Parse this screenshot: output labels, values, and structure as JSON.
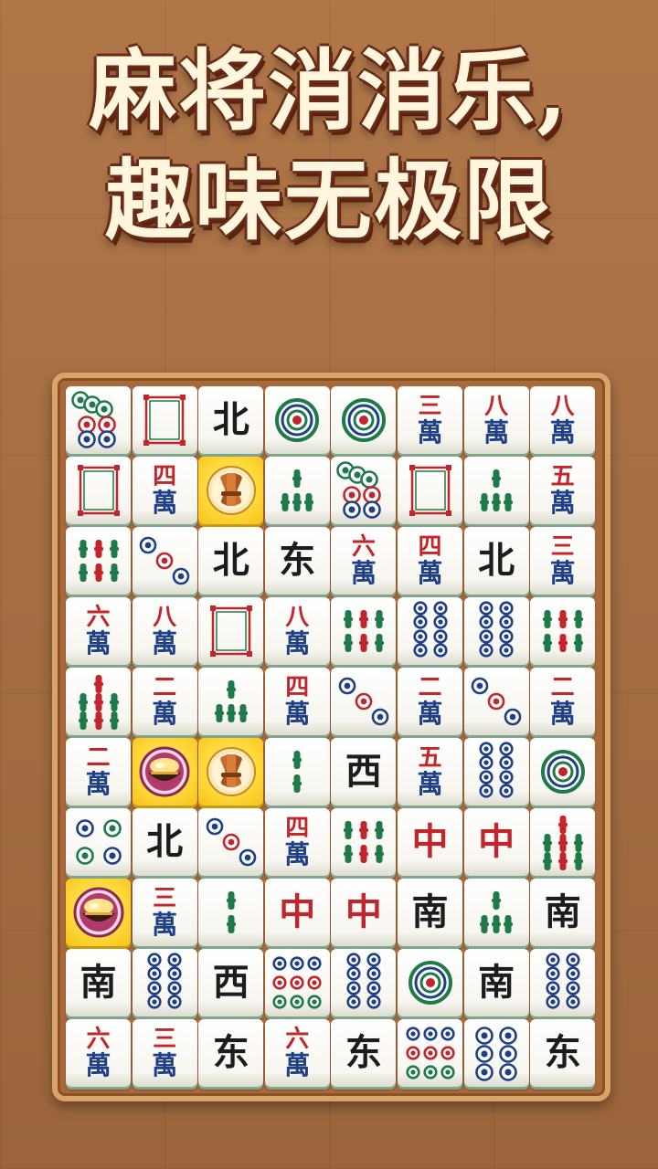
{
  "title": {
    "line1": "麻将消消乐,",
    "line2": "趣味无极限"
  },
  "board": {
    "rows": [
      [
        {
          "k": "dot",
          "n": 7
        },
        {
          "k": "white"
        },
        {
          "k": "char",
          "t": "北"
        },
        {
          "k": "dot",
          "n": 1
        },
        {
          "k": "dot",
          "n": 1
        },
        {
          "k": "wan",
          "n": "三"
        },
        {
          "k": "wan",
          "n": "八"
        },
        {
          "k": "wan",
          "n": "八"
        }
      ],
      [
        {
          "k": "white"
        },
        {
          "k": "wan",
          "n": "四"
        },
        {
          "k": "bamboo-bundle",
          "hl": true
        },
        {
          "k": "bam",
          "n": 5
        },
        {
          "k": "dot",
          "n": 7
        },
        {
          "k": "white"
        },
        {
          "k": "bam",
          "n": 5
        },
        {
          "k": "wan",
          "n": "五"
        }
      ],
      [
        {
          "k": "bam",
          "n": 6
        },
        {
          "k": "dot",
          "n": 3
        },
        {
          "k": "char",
          "t": "北"
        },
        {
          "k": "char",
          "t": "东"
        },
        {
          "k": "wan",
          "n": "六"
        },
        {
          "k": "wan",
          "n": "四"
        },
        {
          "k": "char",
          "t": "北"
        },
        {
          "k": "wan",
          "n": "三"
        }
      ],
      [
        {
          "k": "wan",
          "n": "六"
        },
        {
          "k": "wan",
          "n": "八"
        },
        {
          "k": "white"
        },
        {
          "k": "wan",
          "n": "八"
        },
        {
          "k": "bam",
          "n": 6
        },
        {
          "k": "dot",
          "n": 8
        },
        {
          "k": "dot",
          "n": 8
        },
        {
          "k": "bam",
          "n": 6
        }
      ],
      [
        {
          "k": "bam",
          "n": 9
        },
        {
          "k": "wan",
          "n": "二"
        },
        {
          "k": "bam",
          "n": 5
        },
        {
          "k": "wan",
          "n": "四"
        },
        {
          "k": "dot",
          "n": 3
        },
        {
          "k": "wan",
          "n": "二"
        },
        {
          "k": "dot",
          "n": 3
        },
        {
          "k": "wan",
          "n": "二"
        }
      ],
      [
        {
          "k": "wan",
          "n": "二"
        },
        {
          "k": "gold-pot",
          "hl": true
        },
        {
          "k": "bamboo-bundle",
          "hl": true
        },
        {
          "k": "bam",
          "n": 2
        },
        {
          "k": "char",
          "t": "西"
        },
        {
          "k": "wan",
          "n": "五"
        },
        {
          "k": "dot",
          "n": 8
        },
        {
          "k": "dot",
          "n": 1
        }
      ],
      [
        {
          "k": "dot",
          "n": 4
        },
        {
          "k": "char",
          "t": "北"
        },
        {
          "k": "dot",
          "n": 3
        },
        {
          "k": "wan",
          "n": "四"
        },
        {
          "k": "bam",
          "n": 6
        },
        {
          "k": "char",
          "t": "中"
        },
        {
          "k": "char",
          "t": "中"
        },
        {
          "k": "bam",
          "n": 9
        }
      ],
      [
        {
          "k": "gold-pot",
          "hl": true
        },
        {
          "k": "wan",
          "n": "三"
        },
        {
          "k": "bam",
          "n": 2
        },
        {
          "k": "char",
          "t": "中"
        },
        {
          "k": "char",
          "t": "中"
        },
        {
          "k": "char",
          "t": "南"
        },
        {
          "k": "bam",
          "n": 5
        },
        {
          "k": "char",
          "t": "南"
        }
      ],
      [
        {
          "k": "char",
          "t": "南"
        },
        {
          "k": "dot",
          "n": 8
        },
        {
          "k": "char",
          "t": "西"
        },
        {
          "k": "dot",
          "n": 9
        },
        {
          "k": "dot",
          "n": 8
        },
        {
          "k": "dot",
          "n": 1
        },
        {
          "k": "char",
          "t": "南"
        },
        {
          "k": "dot",
          "n": 8
        }
      ],
      [
        {
          "k": "wan",
          "n": "六"
        },
        {
          "k": "wan",
          "n": "三"
        },
        {
          "k": "char",
          "t": "东"
        },
        {
          "k": "wan",
          "n": "六"
        },
        {
          "k": "char",
          "t": "东"
        },
        {
          "k": "dot",
          "n": 9
        },
        {
          "k": "dot",
          "n": 6
        },
        {
          "k": "char",
          "t": "东"
        }
      ]
    ],
    "wan_glyph": "萬"
  },
  "colors": {
    "red": "#c0262b",
    "blue": "#1f3f86",
    "green": "#1f7a4a",
    "black": "#1c1c1c",
    "highlight": "#ffd83a"
  }
}
